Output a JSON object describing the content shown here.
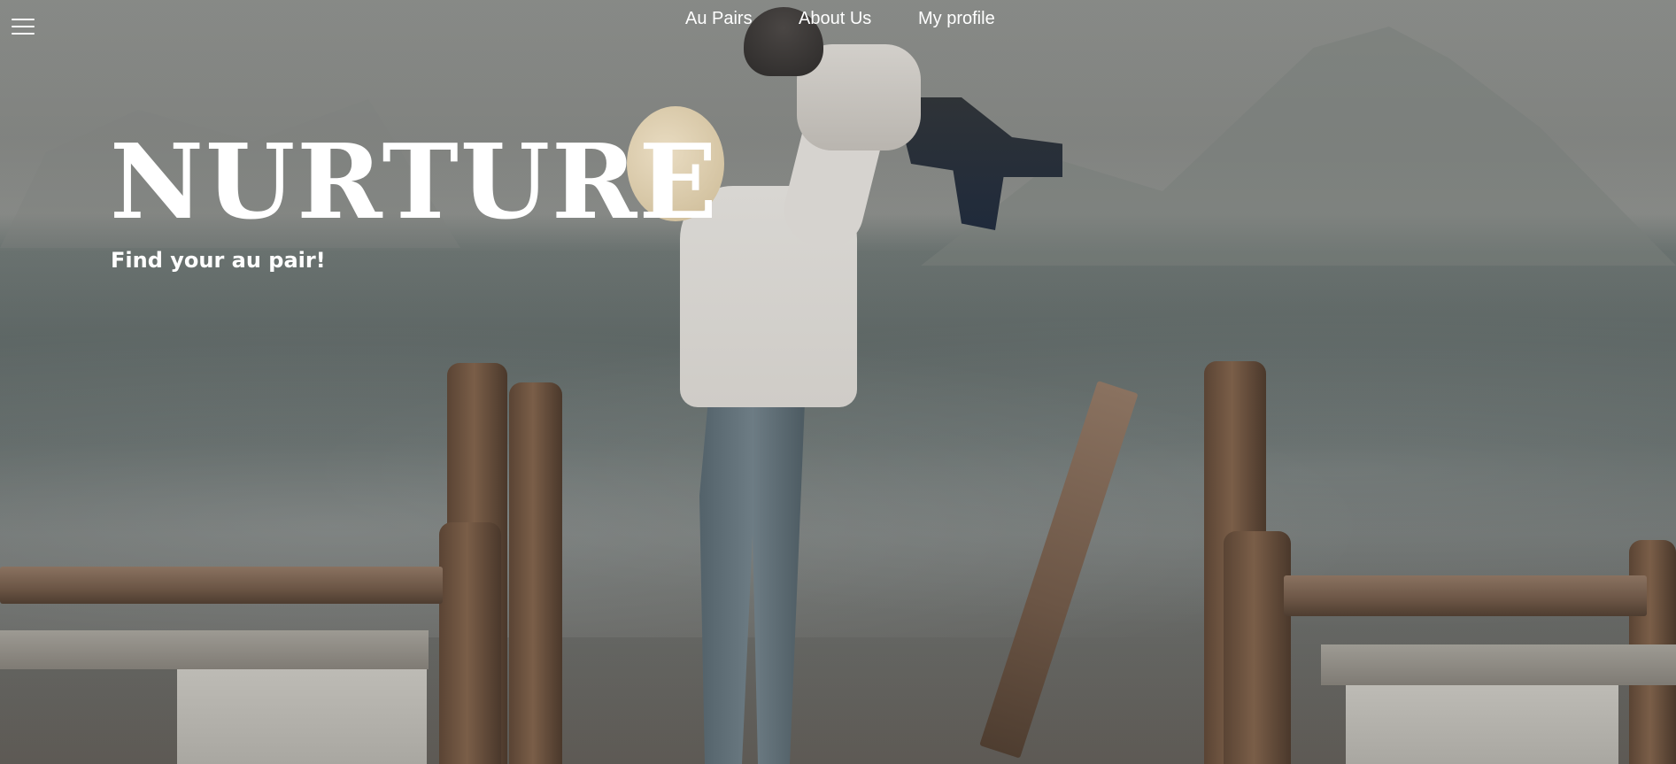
{
  "nav": {
    "menu_icon": "hamburger-menu-icon",
    "links": [
      {
        "label": "Au Pairs"
      },
      {
        "label": "About Us"
      },
      {
        "label": "My profile"
      }
    ]
  },
  "hero": {
    "title": "NURTURE",
    "subtitle": "Find your au pair!",
    "background_image_alt": "woman lifting child by the sea"
  },
  "colors": {
    "text": "#ffffff",
    "overlay": "#4a4a4a"
  }
}
